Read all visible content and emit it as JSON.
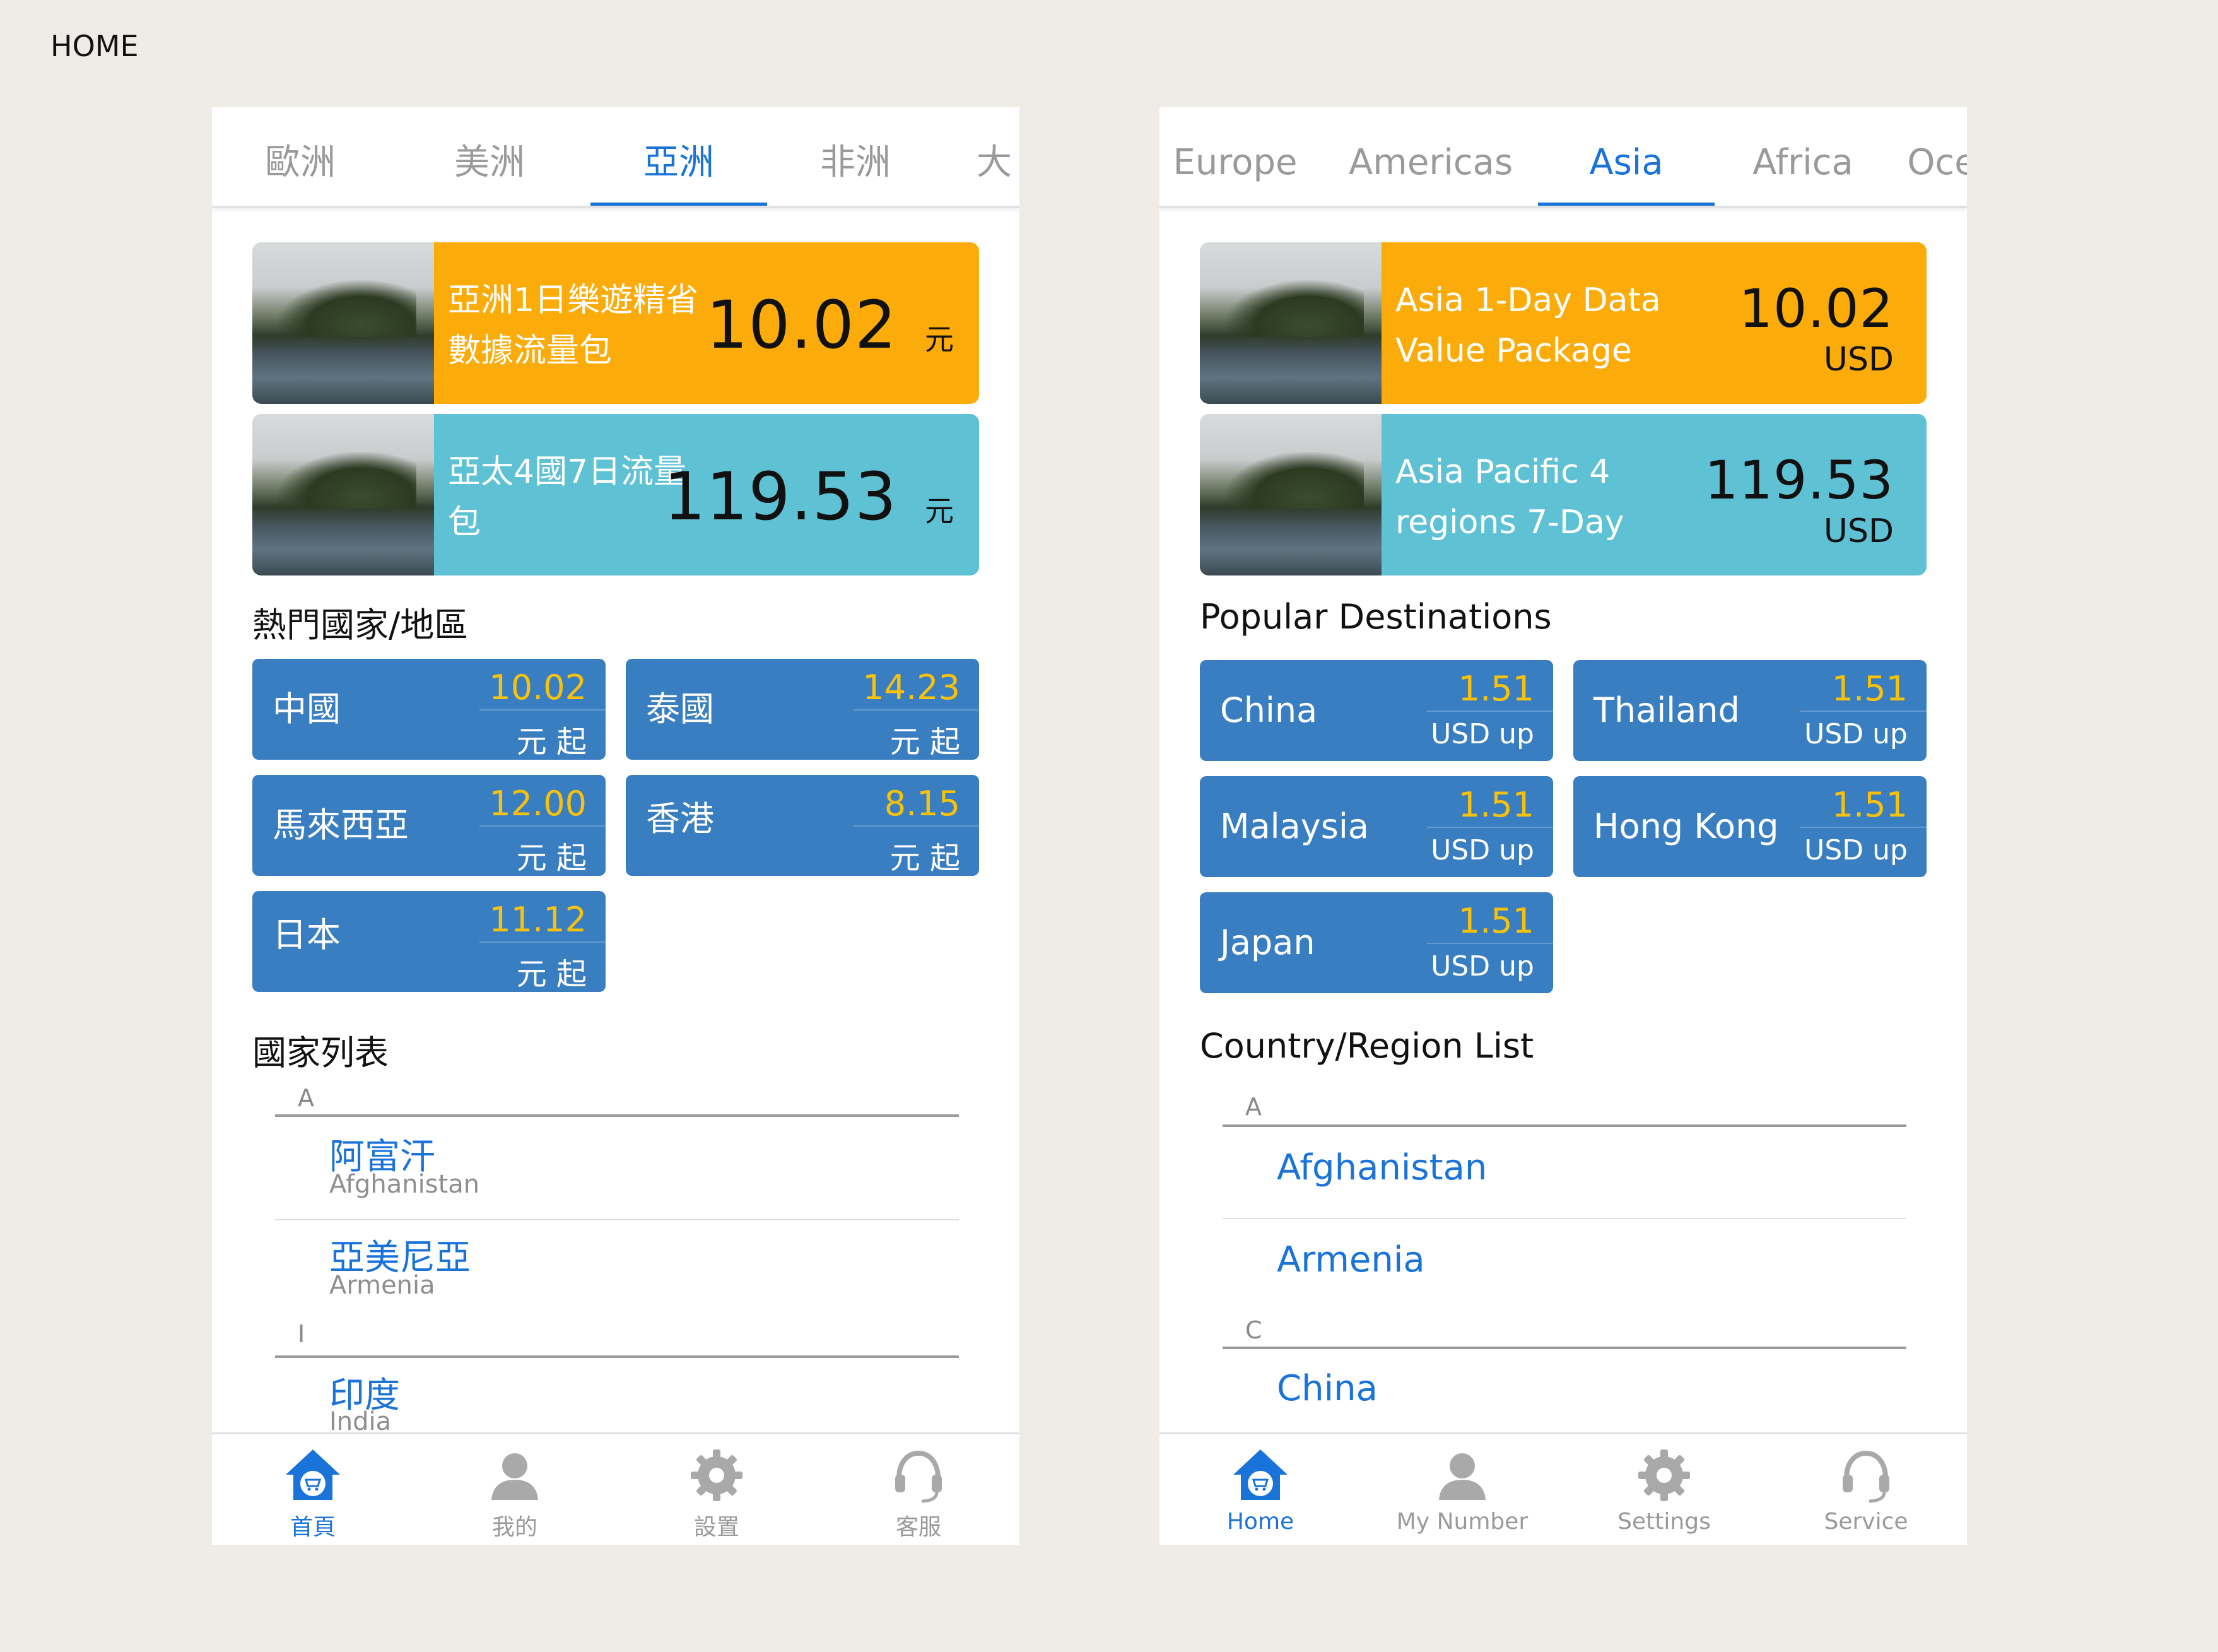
{
  "page_title": "HOME",
  "left": {
    "tabs": [
      "歐洲",
      "美洲",
      "亞洲",
      "非洲",
      "大"
    ],
    "active_tab": 2,
    "banners": [
      {
        "name": "亞洲1日樂遊精省數據流量包",
        "price": "10.02",
        "unit": "元",
        "color": "#fbac0a"
      },
      {
        "name": "亞太4國7日流量包",
        "price": "119.53",
        "unit": "元",
        "color": "#5fc1d4"
      }
    ],
    "popular_title": "熱門國家/地區",
    "popular": [
      {
        "name": "中國",
        "price": "10.02",
        "unit": "元 起"
      },
      {
        "name": "泰國",
        "price": "14.23",
        "unit": "元 起"
      },
      {
        "name": "馬來西亞",
        "price": "12.00",
        "unit": "元 起"
      },
      {
        "name": "香港",
        "price": "8.15",
        "unit": "元 起"
      },
      {
        "name": "日本",
        "price": "11.12",
        "unit": "元 起"
      }
    ],
    "list_title": "國家列表",
    "list": [
      {
        "letter": "A"
      },
      {
        "cn": "阿富汗",
        "en": "Afghanistan"
      },
      {
        "cn": "亞美尼亞",
        "en": "Armenia"
      },
      {
        "letter": "I"
      },
      {
        "cn": "印度",
        "en": "India"
      }
    ],
    "nav": [
      {
        "label": "首頁",
        "icon": "home-cart-icon"
      },
      {
        "label": "我的",
        "icon": "user-icon"
      },
      {
        "label": "設置",
        "icon": "gear-icon"
      },
      {
        "label": "客服",
        "icon": "headset-icon"
      }
    ]
  },
  "right": {
    "tabs": [
      "Europe",
      "Americas",
      "Asia",
      "Africa",
      "Oce"
    ],
    "active_tab": 2,
    "banners": [
      {
        "name": "Asia 1-Day Data Value Package",
        "price": "10.02",
        "unit": "USD",
        "color": "#fbac0a"
      },
      {
        "name": "Asia Pacific 4 regions 7-Day",
        "price": "119.53",
        "unit": "USD",
        "color": "#5fc1d4"
      }
    ],
    "popular_title": "Popular Destinations",
    "popular": [
      {
        "name": "China",
        "price": "1.51",
        "unit": "USD up"
      },
      {
        "name": "Thailand",
        "price": "1.51",
        "unit": "USD up"
      },
      {
        "name": "Malaysia",
        "price": "1.51",
        "unit": "USD up"
      },
      {
        "name": "Hong Kong",
        "price": "1.51",
        "unit": "USD up"
      },
      {
        "name": "Japan",
        "price": "1.51",
        "unit": "USD up"
      }
    ],
    "list_title": "Country/Region List",
    "list": [
      {
        "letter": "A"
      },
      {
        "en": "Afghanistan"
      },
      {
        "en": "Armenia"
      },
      {
        "letter": "C"
      },
      {
        "en": "China"
      }
    ],
    "nav": [
      {
        "label": "Home",
        "icon": "home-cart-icon"
      },
      {
        "label": "My Number",
        "icon": "user-icon"
      },
      {
        "label": "Settings",
        "icon": "gear-icon"
      },
      {
        "label": "Service",
        "icon": "headset-icon"
      }
    ]
  },
  "colors": {
    "accent": "#1a73d9",
    "card": "#3a7ec2",
    "price_yellow": "#f9c20a",
    "banner_orange": "#fbac0a",
    "banner_teal": "#5fc1d4"
  }
}
